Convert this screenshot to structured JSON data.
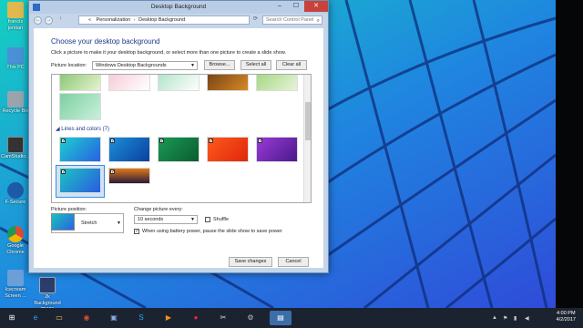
{
  "desktop": {
    "icons": [
      {
        "label": "francis jenitan",
        "icon": "user-folder-icon",
        "color": "#e0b84f"
      },
      {
        "label": "This PC",
        "icon": "computer-icon",
        "color": "#4a90d9"
      },
      {
        "label": "Recycle Bin",
        "icon": "recycle-bin-icon",
        "color": "#9aa4ad"
      },
      {
        "label": "CamStudio...",
        "icon": "camstudio-icon",
        "color": "#333333"
      },
      {
        "label": "F-Secure",
        "icon": "f-secure-icon",
        "color": "#1e5aa8"
      },
      {
        "label": "Google Chrome",
        "icon": "chrome-icon",
        "color": "#dd4b39"
      },
      {
        "label": "Icecream Screen ...",
        "icon": "icecream-icon",
        "color": "#6a9fd8"
      },
      {
        "label": "2k Background image",
        "icon": "image-file-icon",
        "color": "#2a3d6d"
      }
    ]
  },
  "window": {
    "title": "Desktop Background",
    "controls": {
      "minimize": "–",
      "maximize": "☐",
      "close": "✕"
    },
    "nav": {
      "back": "←",
      "forward": "→",
      "up": "↑",
      "refresh": "⟳"
    },
    "breadcrumb": [
      "Personalization",
      "Desktop Background"
    ],
    "breadcrumb_prefix": "«",
    "search_placeholder": "Search Control Panel"
  },
  "main": {
    "heading": "Choose your desktop background",
    "description": "Click a picture to make it your desktop background, or select more than one picture to create a slide show.",
    "picture_location_label": "Picture location:",
    "picture_location_value": "Windows Desktop Backgrounds",
    "browse_label": "Browse...",
    "select_all_label": "Select all",
    "clear_all_label": "Clear all",
    "group_title": "Lines and colors (7)",
    "pictures_top": [
      {
        "colors": [
          "#7dc36a",
          "#e8f2d0"
        ]
      },
      {
        "colors": [
          "#f4c6d2",
          "#ffffff"
        ]
      },
      {
        "colors": [
          "#a8e0c0",
          "#ffffff"
        ]
      },
      {
        "colors": [
          "#6b3a14",
          "#d88a24"
        ]
      },
      {
        "colors": [
          "#9dd47a",
          "#e7f3d8"
        ]
      }
    ],
    "pictures_lines": [
      {
        "colors": [
          "#1ad0d0",
          "#2a60e0"
        ],
        "checked": true
      },
      {
        "colors": [
          "#1e8fd8",
          "#0a3fa0"
        ],
        "checked": true
      },
      {
        "colors": [
          "#1a9a56",
          "#0b5c2f"
        ],
        "checked": true
      },
      {
        "colors": [
          "#ff5a1a",
          "#e0260e"
        ],
        "checked": true
      },
      {
        "colors": [
          "#9a3ad8",
          "#4a1a8a"
        ],
        "checked": true
      },
      {
        "colors": [
          "#1ac6c0",
          "#2a5ae0"
        ],
        "checked": true,
        "selected": true
      },
      {
        "colors": [
          "#e07a1a",
          "#2a1a3a"
        ],
        "checked": true
      }
    ],
    "extra_picture": {
      "colors": [
        "#7ed0a0",
        "#c8f0dc"
      ]
    },
    "check_glyph": "✓",
    "picture_position_label": "Picture position:",
    "picture_position_value": "Stretch",
    "change_every_label": "Change picture every:",
    "change_every_value": "10 seconds",
    "shuffle_label": "Shuffle",
    "shuffle_checked": false,
    "battery_label": "When using battery power, pause the slide show to save power",
    "battery_checked": true,
    "save_label": "Save changes",
    "cancel_label": "Cancel"
  },
  "taskbar": {
    "time": "4:00 PM",
    "date": "4/2/2017",
    "items": [
      {
        "icon": "start-icon",
        "glyph": "⊞",
        "color": "#1c2330"
      },
      {
        "icon": "internet-explorer-icon",
        "glyph": "e",
        "color": "#1c2330"
      },
      {
        "icon": "file-explorer-icon",
        "glyph": "▭",
        "color": "#1c2330"
      },
      {
        "icon": "chrome-icon",
        "glyph": "◉",
        "color": "#1c2330"
      },
      {
        "icon": "store-icon",
        "glyph": "▣",
        "color": "#1c2330"
      },
      {
        "icon": "skype-icon",
        "glyph": "S",
        "color": "#1c2330"
      },
      {
        "icon": "media-player-icon",
        "glyph": "▶",
        "color": "#1c2330"
      },
      {
        "icon": "recorder-icon",
        "glyph": "●",
        "color": "#1c2330"
      },
      {
        "icon": "snipping-icon",
        "glyph": "✂",
        "color": "#1c2330"
      },
      {
        "icon": "tools-icon",
        "glyph": "⚙",
        "color": "#1c2330"
      },
      {
        "icon": "control-panel-icon",
        "glyph": "▤",
        "color": "#3b6ea8"
      }
    ]
  }
}
